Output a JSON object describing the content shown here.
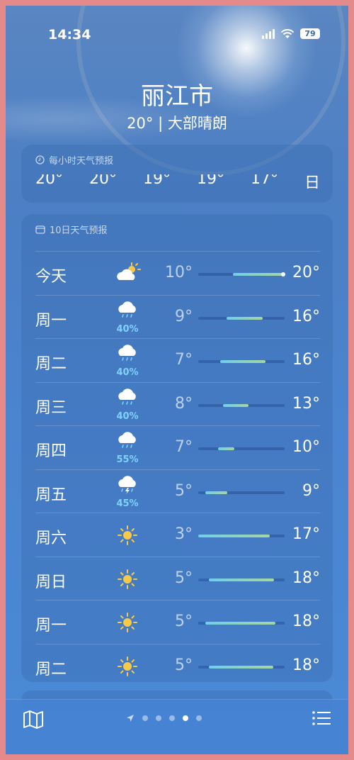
{
  "status_bar": {
    "time": "14:34",
    "battery": "79"
  },
  "location": {
    "city": "丽江市",
    "summary": "20° | 大部晴朗"
  },
  "hourly": {
    "title": "每小时天气预报",
    "temps": [
      "20°",
      "20°",
      "19°",
      "19°",
      "17°",
      "日落"
    ]
  },
  "daily": {
    "title": "10日天气预报",
    "days": [
      {
        "name": "今天",
        "icon": "partly-sunny-icon",
        "pop": "",
        "low": "10°",
        "high": "20°",
        "bar_start": 0.4,
        "bar_end": 0.98,
        "current": 0.98
      },
      {
        "name": "周一",
        "icon": "rain-cloud-icon",
        "pop": "40%",
        "low": "9°",
        "high": "16°",
        "bar_start": 0.33,
        "bar_end": 0.75
      },
      {
        "name": "周二",
        "icon": "rain-cloud-icon",
        "pop": "40%",
        "low": "7°",
        "high": "16°",
        "bar_start": 0.25,
        "bar_end": 0.78
      },
      {
        "name": "周三",
        "icon": "rain-cloud-icon",
        "pop": "40%",
        "low": "8°",
        "high": "13°",
        "bar_start": 0.29,
        "bar_end": 0.58
      },
      {
        "name": "周四",
        "icon": "rain-cloud-icon",
        "pop": "55%",
        "low": "7°",
        "high": "10°",
        "bar_start": 0.23,
        "bar_end": 0.42
      },
      {
        "name": "周五",
        "icon": "thunderstorm-icon",
        "pop": "45%",
        "low": "5°",
        "high": "9°",
        "bar_start": 0.08,
        "bar_end": 0.34
      },
      {
        "name": "周六",
        "icon": "sun-icon",
        "pop": "",
        "low": "3°",
        "high": "17°",
        "bar_start": 0.0,
        "bar_end": 0.83
      },
      {
        "name": "周日",
        "icon": "sun-icon",
        "pop": "",
        "low": "5°",
        "high": "18°",
        "bar_start": 0.12,
        "bar_end": 0.88
      },
      {
        "name": "周一",
        "icon": "sun-icon",
        "pop": "",
        "low": "5°",
        "high": "18°",
        "bar_start": 0.08,
        "bar_end": 0.89
      },
      {
        "name": "周二",
        "icon": "sun-icon",
        "pop": "",
        "low": "5°",
        "high": "18°",
        "bar_start": 0.12,
        "bar_end": 0.87
      }
    ]
  },
  "page_dots": {
    "count": 5,
    "active_index": 4
  }
}
